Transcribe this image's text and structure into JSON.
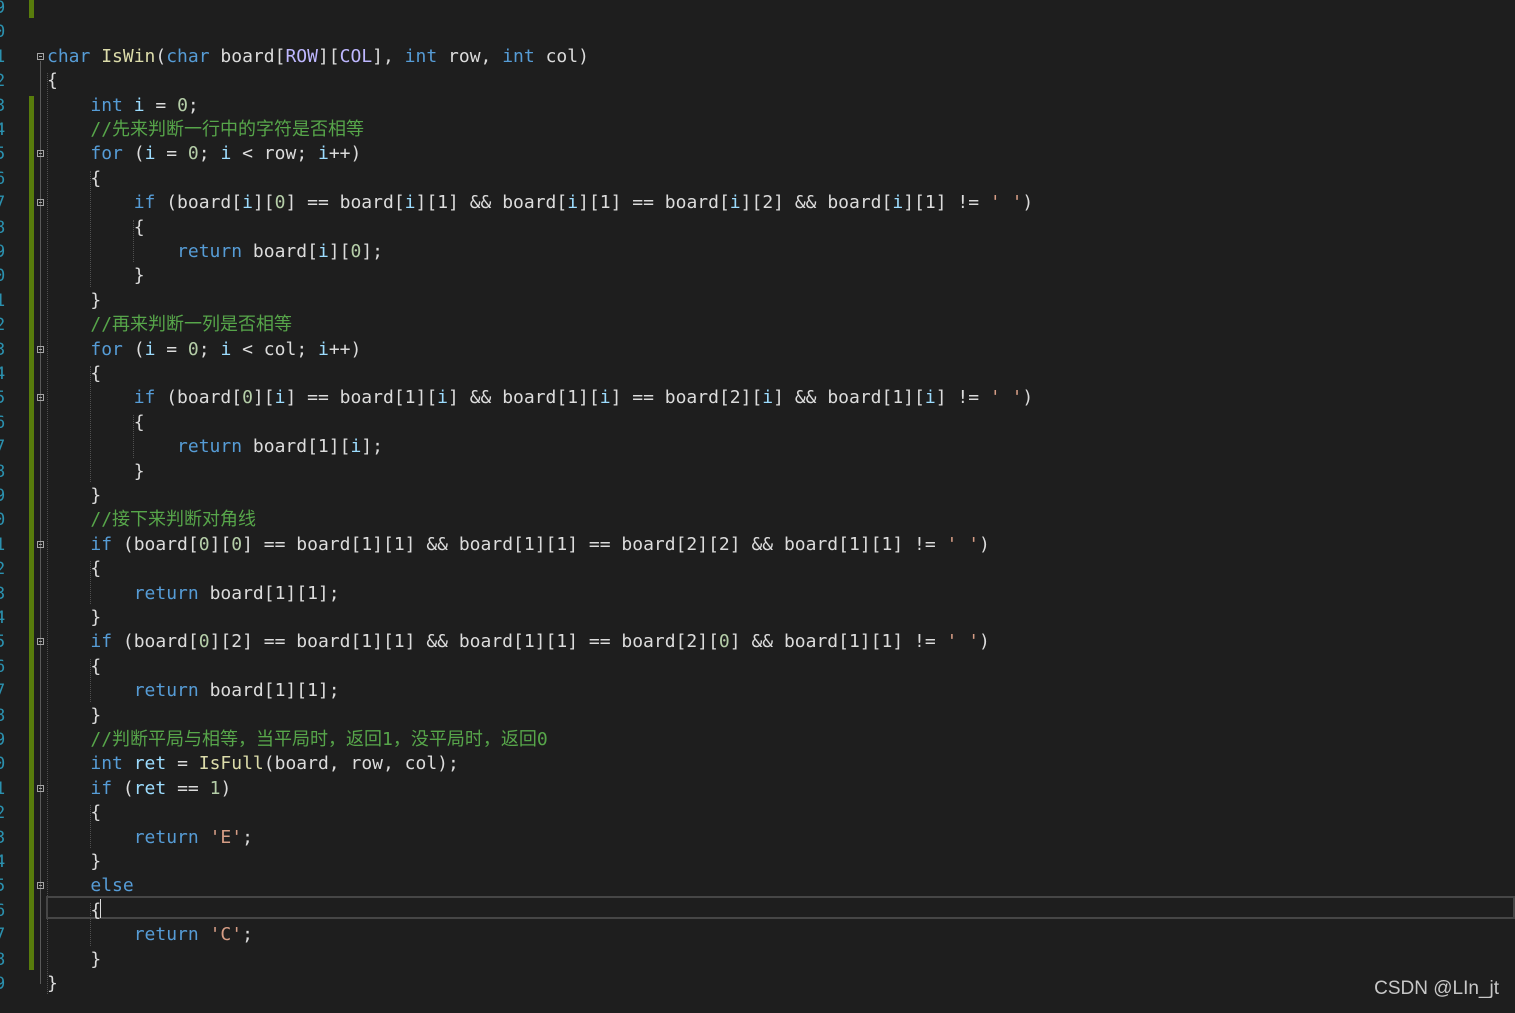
{
  "editor": {
    "gutter_numbers": [
      "9",
      "0",
      "1",
      "2",
      "3",
      "4",
      "5",
      "6",
      "7",
      "8",
      "9",
      "0",
      "1",
      "2",
      "3",
      "4",
      "5",
      "6",
      "7",
      "8",
      "9",
      "0",
      "1",
      "2",
      "3",
      "4",
      "5",
      "6",
      "7",
      "8",
      "9",
      "0",
      "1",
      "2",
      "3",
      "4",
      "5",
      "6",
      "7",
      "8",
      "9"
    ],
    "lines": [
      [],
      [],
      [
        [
          "k",
          "char "
        ],
        [
          "f",
          "IsWin"
        ],
        [
          "p",
          "("
        ],
        [
          "k",
          "char "
        ],
        [
          "p",
          "board["
        ],
        [
          "m",
          "ROW"
        ],
        [
          "p",
          "]["
        ],
        [
          "m",
          "COL"
        ],
        [
          "p",
          "], "
        ],
        [
          "k",
          "int "
        ],
        [
          "p",
          "row, "
        ],
        [
          "k",
          "int "
        ],
        [
          "p",
          "col)"
        ]
      ],
      [
        [
          "p",
          "{"
        ]
      ],
      [
        [
          "p",
          "    "
        ],
        [
          "k",
          "int "
        ],
        [
          "v",
          "i"
        ],
        [
          "p",
          " = "
        ],
        [
          "n",
          "0"
        ],
        [
          "p",
          ";"
        ]
      ],
      [
        [
          "p",
          "    "
        ],
        [
          "c",
          "//先来判断一行中的字符是否相等"
        ]
      ],
      [
        [
          "p",
          "    "
        ],
        [
          "k",
          "for "
        ],
        [
          "p",
          "("
        ],
        [
          "v",
          "i"
        ],
        [
          "p",
          " = "
        ],
        [
          "n",
          "0"
        ],
        [
          "p",
          "; "
        ],
        [
          "v",
          "i"
        ],
        [
          "p",
          " < row; "
        ],
        [
          "v",
          "i"
        ],
        [
          "p",
          "++)"
        ]
      ],
      [
        [
          "p",
          "    {"
        ]
      ],
      [
        [
          "p",
          "        "
        ],
        [
          "k",
          "if "
        ],
        [
          "p",
          "(board["
        ],
        [
          "v",
          "i"
        ],
        [
          "p",
          "]["
        ],
        [
          "n",
          "0"
        ],
        [
          "p",
          "] == board["
        ],
        [
          "v",
          "i"
        ],
        [
          "p",
          "][1] && board["
        ],
        [
          "v",
          "i"
        ],
        [
          "p",
          "][1] == board["
        ],
        [
          "v",
          "i"
        ],
        [
          "p",
          "][2] && board["
        ],
        [
          "v",
          "i"
        ],
        [
          "p",
          "][1] != "
        ],
        [
          "s",
          "' '"
        ],
        [
          "p",
          ")"
        ]
      ],
      [
        [
          "p",
          "        {"
        ]
      ],
      [
        [
          "p",
          "            "
        ],
        [
          "k",
          "return "
        ],
        [
          "p",
          "board["
        ],
        [
          "v",
          "i"
        ],
        [
          "p",
          "]["
        ],
        [
          "n",
          "0"
        ],
        [
          "p",
          "];"
        ]
      ],
      [
        [
          "p",
          "        }"
        ]
      ],
      [
        [
          "p",
          "    }"
        ]
      ],
      [
        [
          "p",
          "    "
        ],
        [
          "c",
          "//再来判断一列是否相等"
        ]
      ],
      [
        [
          "p",
          "    "
        ],
        [
          "k",
          "for "
        ],
        [
          "p",
          "("
        ],
        [
          "v",
          "i"
        ],
        [
          "p",
          " = "
        ],
        [
          "n",
          "0"
        ],
        [
          "p",
          "; "
        ],
        [
          "v",
          "i"
        ],
        [
          "p",
          " < col; "
        ],
        [
          "v",
          "i"
        ],
        [
          "p",
          "++)"
        ]
      ],
      [
        [
          "p",
          "    {"
        ]
      ],
      [
        [
          "p",
          "        "
        ],
        [
          "k",
          "if "
        ],
        [
          "p",
          "(board["
        ],
        [
          "n",
          "0"
        ],
        [
          "p",
          "]["
        ],
        [
          "v",
          "i"
        ],
        [
          "p",
          "] == board[1]["
        ],
        [
          "v",
          "i"
        ],
        [
          "p",
          "] && board[1]["
        ],
        [
          "v",
          "i"
        ],
        [
          "p",
          "] == board[2]["
        ],
        [
          "v",
          "i"
        ],
        [
          "p",
          "] && board[1]["
        ],
        [
          "v",
          "i"
        ],
        [
          "p",
          "] != "
        ],
        [
          "s",
          "' '"
        ],
        [
          "p",
          ")"
        ]
      ],
      [
        [
          "p",
          "        {"
        ]
      ],
      [
        [
          "p",
          "            "
        ],
        [
          "k",
          "return "
        ],
        [
          "p",
          "board[1]["
        ],
        [
          "v",
          "i"
        ],
        [
          "p",
          "];"
        ]
      ],
      [
        [
          "p",
          "        }"
        ]
      ],
      [
        [
          "p",
          "    }"
        ]
      ],
      [
        [
          "p",
          "    "
        ],
        [
          "c",
          "//接下来判断对角线"
        ]
      ],
      [
        [
          "p",
          "    "
        ],
        [
          "k",
          "if "
        ],
        [
          "p",
          "(board["
        ],
        [
          "n",
          "0"
        ],
        [
          "p",
          "]["
        ],
        [
          "n",
          "0"
        ],
        [
          "p",
          "] == board[1][1] && board[1][1] == board[2][2] && board[1][1] != "
        ],
        [
          "s",
          "' '"
        ],
        [
          "p",
          ")"
        ]
      ],
      [
        [
          "p",
          "    {"
        ]
      ],
      [
        [
          "p",
          "        "
        ],
        [
          "k",
          "return "
        ],
        [
          "p",
          "board[1][1];"
        ]
      ],
      [
        [
          "p",
          "    }"
        ]
      ],
      [
        [
          "p",
          "    "
        ],
        [
          "k",
          "if "
        ],
        [
          "p",
          "(board["
        ],
        [
          "n",
          "0"
        ],
        [
          "p",
          "][2] == board[1][1] && board[1][1] == board[2]["
        ],
        [
          "n",
          "0"
        ],
        [
          "p",
          "] && board[1][1] != "
        ],
        [
          "s",
          "' '"
        ],
        [
          "p",
          ")"
        ]
      ],
      [
        [
          "p",
          "    {"
        ]
      ],
      [
        [
          "p",
          "        "
        ],
        [
          "k",
          "return "
        ],
        [
          "p",
          "board[1][1];"
        ]
      ],
      [
        [
          "p",
          "    }"
        ]
      ],
      [
        [
          "p",
          "    "
        ],
        [
          "c",
          "//判断平局与相等，当平局时，返回1，没平局时，返回0"
        ]
      ],
      [
        [
          "p",
          "    "
        ],
        [
          "k",
          "int "
        ],
        [
          "v",
          "ret"
        ],
        [
          "p",
          " = "
        ],
        [
          "f",
          "IsFull"
        ],
        [
          "p",
          "(board, row, col);"
        ]
      ],
      [
        [
          "p",
          "    "
        ],
        [
          "k",
          "if "
        ],
        [
          "p",
          "("
        ],
        [
          "v",
          "ret"
        ],
        [
          "p",
          " == "
        ],
        [
          "n",
          "1"
        ],
        [
          "p",
          ")"
        ]
      ],
      [
        [
          "p",
          "    {"
        ]
      ],
      [
        [
          "p",
          "        "
        ],
        [
          "k",
          "return "
        ],
        [
          "s",
          "'E'"
        ],
        [
          "p",
          ";"
        ]
      ],
      [
        [
          "p",
          "    }"
        ]
      ],
      [
        [
          "p",
          "    "
        ],
        [
          "k",
          "else"
        ]
      ],
      [
        [
          "p",
          "    {"
        ]
      ],
      [
        [
          "p",
          "        "
        ],
        [
          "k",
          "return "
        ],
        [
          "s",
          "'C'"
        ],
        [
          "p",
          ";"
        ]
      ],
      [
        [
          "p",
          "    }"
        ]
      ],
      [
        [
          "p",
          "}"
        ]
      ]
    ]
  },
  "watermark": "CSDN @LIn_jt",
  "colors": {
    "background": "#1e1e1e",
    "keyword": "#569cd6",
    "function": "#dcdcaa",
    "macro": "#beb7ff",
    "number": "#b5cea8",
    "string": "#d69d85",
    "comment": "#57a64a",
    "variable": "#9cdcfe",
    "line_number": "#2b91af",
    "change_bar": "#587c0c"
  },
  "icons": [
    "fold-collapse-icon"
  ]
}
